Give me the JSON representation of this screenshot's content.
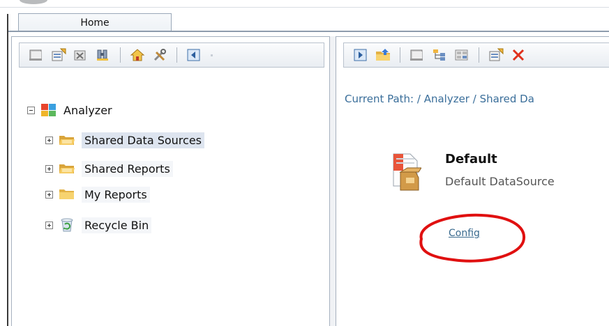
{
  "tabs": {
    "home_label": "Home"
  },
  "left_toolbar": {
    "buttons": [
      {
        "icon": "new-folder-icon"
      },
      {
        "icon": "properties-icon"
      },
      {
        "icon": "delete-icon"
      },
      {
        "icon": "find-icon"
      },
      {
        "icon": "home-icon"
      },
      {
        "icon": "tools-icon"
      },
      {
        "icon": "collapse-panel-icon"
      }
    ]
  },
  "right_toolbar": {
    "buttons": [
      {
        "icon": "go-icon"
      },
      {
        "icon": "up-folder-icon"
      },
      {
        "icon": "new-folder-icon"
      },
      {
        "icon": "tree-view-icon"
      },
      {
        "icon": "grid-view-icon"
      },
      {
        "icon": "properties-icon"
      },
      {
        "icon": "delete-icon"
      }
    ]
  },
  "tree": {
    "root": {
      "label": "Analyzer",
      "expanded": true,
      "icon": "analyzer-icon"
    },
    "children": [
      {
        "label": "Shared Data Sources",
        "selected": true,
        "icon": "folder-open-icon"
      },
      {
        "label": "Shared Reports",
        "selected": false,
        "icon": "folder-open-icon"
      },
      {
        "label": "My Reports",
        "selected": false,
        "icon": "folder-icon"
      },
      {
        "label": "Recycle Bin",
        "selected": false,
        "icon": "recycle-bin-icon"
      }
    ]
  },
  "content": {
    "current_path": "Current Path: / Analyzer / Shared Da",
    "datasource": {
      "title": "Default",
      "description": "Default DataSource",
      "icon": "datasource-icon",
      "config_link": "Config"
    }
  },
  "colors": {
    "highlight_ellipse": "#e01010",
    "selection_bg": "#dde4ef",
    "path_text": "#3a6e9a",
    "border": "#a6b1bf"
  }
}
